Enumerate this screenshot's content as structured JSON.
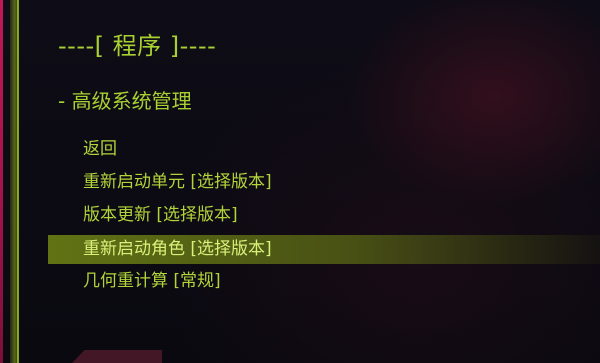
{
  "header": {
    "title": "----[ 程序 ]----"
  },
  "section": {
    "title": "- 高级系统管理"
  },
  "menu": {
    "items": [
      {
        "label": "返回"
      },
      {
        "label": "重新启动单元 [选择版本]"
      },
      {
        "label": "版本更新 [选择版本]"
      },
      {
        "label": "重新启动角色 [选择版本]"
      },
      {
        "label": "几何重计算 [常规]"
      }
    ],
    "selected_index": 3
  },
  "colors": {
    "text_green": "#a9d033",
    "highlight_bar": "#667814",
    "left_edge": "#c21856"
  }
}
